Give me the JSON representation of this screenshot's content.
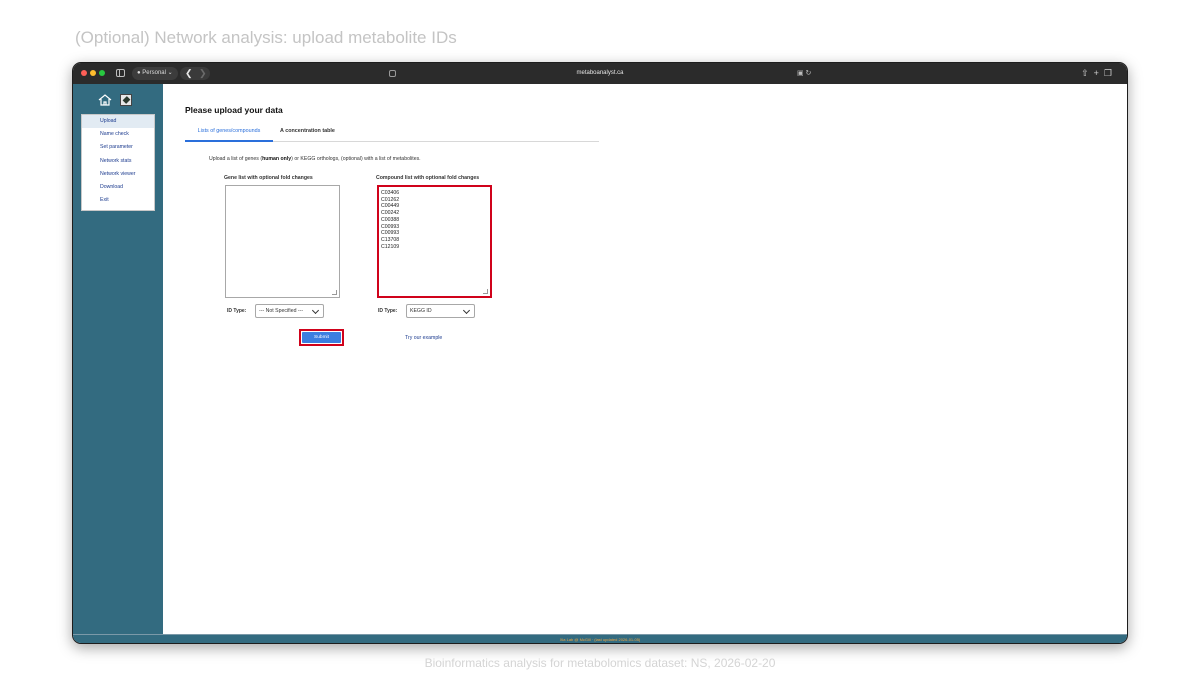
{
  "slide": {
    "title": "(Optional) Network analysis: upload metabolite IDs",
    "footer": "Bioinformatics analysis for metabolomics dataset: NS, 2026-02-20"
  },
  "browser": {
    "profile_label": "Personal",
    "url": "metaboanalyst.ca"
  },
  "sidebar": {
    "items": [
      {
        "label": "Upload",
        "active": true
      },
      {
        "label": "Name check"
      },
      {
        "label": "Set parameter"
      },
      {
        "label": "Network stats"
      },
      {
        "label": "Network viewer"
      },
      {
        "label": "Download"
      },
      {
        "label": "Exit"
      }
    ]
  },
  "main": {
    "heading": "Please upload your data",
    "tabs": [
      {
        "label": "Lists of genes/compounds",
        "active": true
      },
      {
        "label": "A concentration table"
      }
    ],
    "description": {
      "before": "Upload a list of genes (",
      "bold": "human only",
      "after": ") or KEGG orthologs, (optional) with a list of metabolites."
    },
    "gene_list": {
      "label": "Gene list with optional fold changes",
      "value": "",
      "id_type_label": "ID Type:",
      "id_type_value": "--- Not Specified ---"
    },
    "compound_list": {
      "label": "Compound list with optional fold changes",
      "lines": [
        "C03406",
        "C01262",
        "C00449",
        "C00242",
        "C00388",
        "C00993",
        "C00993",
        "C13708",
        "C12109"
      ],
      "id_type_label": "ID Type:",
      "id_type_value": "KEGG ID"
    },
    "submit_label": "Submit",
    "example_link": "Try our example"
  },
  "status_bar": {
    "text": "Xia Lab @ McGill · (last updated 2026-01-05)"
  },
  "colors": {
    "sidebar_bg": "#336b80",
    "accent": "#2a6fdb",
    "highlight": "#d0021b"
  }
}
